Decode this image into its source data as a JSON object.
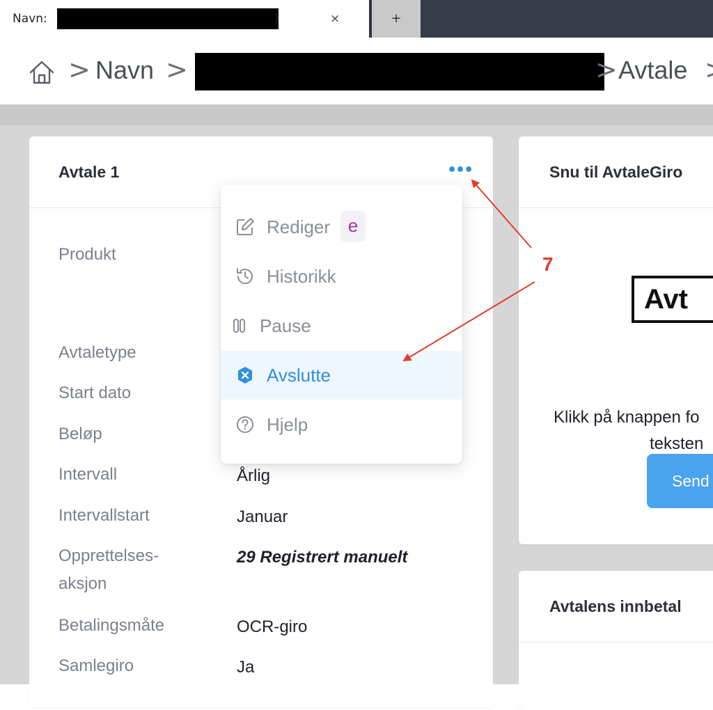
{
  "tabbar": {
    "tab_label": "Navn:",
    "tab_paren": ")",
    "close_glyph": "×",
    "new_tab_glyph": "+"
  },
  "breadcrumb": {
    "items": [
      "Navn",
      "Avtale"
    ],
    "separator": ">"
  },
  "main_card": {
    "title": "Avtale 1",
    "more_glyph": "•••",
    "fields": [
      {
        "label": "Produkt",
        "value": ""
      },
      {
        "label": "Avtaletype",
        "value": ""
      },
      {
        "label": "Start dato",
        "value": ""
      },
      {
        "label": "Beløp",
        "value": ""
      },
      {
        "label": "Intervall",
        "value": "Årlig"
      },
      {
        "label": "Intervallstart",
        "value": "Januar"
      },
      {
        "label": "Opprettelses-\naksjon",
        "value": "29 Registrert manuelt"
      },
      {
        "label": "Betalingsmåte",
        "value": "OCR-giro"
      },
      {
        "label": "Samlegiro",
        "value": "Ja"
      }
    ]
  },
  "menu": {
    "items": [
      {
        "label": "Rediger",
        "icon": "edit-icon",
        "shortcut": "e"
      },
      {
        "label": "Historikk",
        "icon": "history-icon"
      },
      {
        "label": "Pause",
        "icon": "pause-icon"
      },
      {
        "label": "Avslutte",
        "icon": "close-circle-icon",
        "active": true
      },
      {
        "label": "Hjelp",
        "icon": "help-icon"
      }
    ]
  },
  "right_card_1": {
    "title": "Snu til AvtaleGiro",
    "logo_text": "Avt",
    "text_line1": "Klikk på knappen fo",
    "text_line2": "teksten",
    "button_label": "Send"
  },
  "right_card_2": {
    "title": "Avtalens innbetal"
  },
  "annotation": {
    "number": "7",
    "color": "#e23b2b"
  },
  "colors": {
    "accent": "#2f8fe0",
    "button": "#4aa3ee",
    "shortcut": "#a0399a"
  }
}
